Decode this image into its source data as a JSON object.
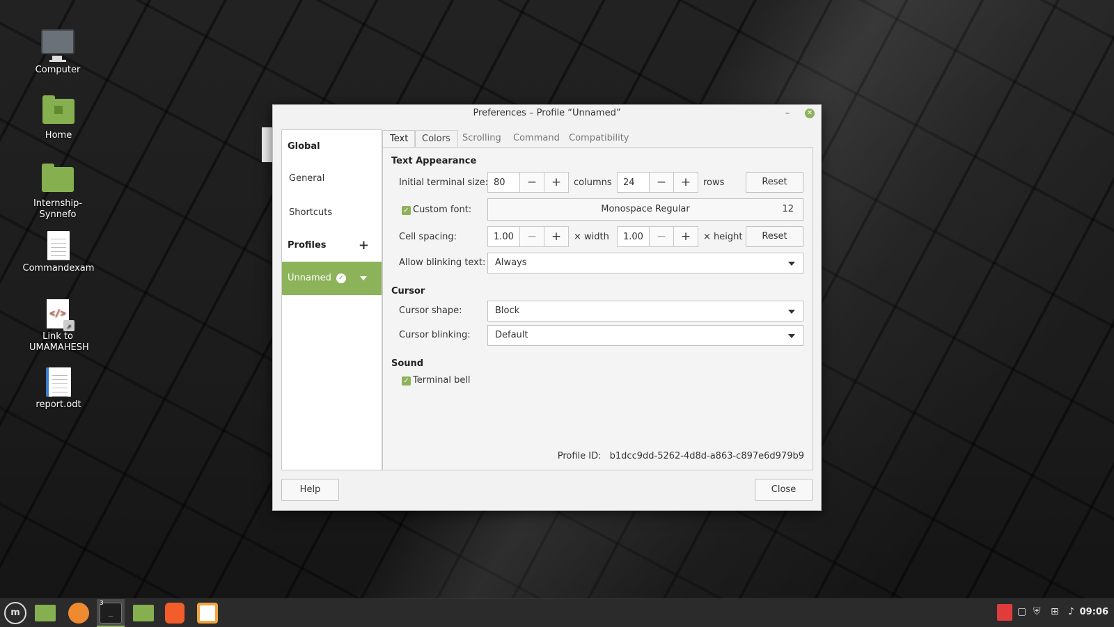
{
  "desktop": {
    "icons": [
      {
        "label": "Computer"
      },
      {
        "label": "Home"
      },
      {
        "label": "Internship-Synnefo"
      },
      {
        "label": "Commandexam"
      },
      {
        "label": "Link to UMAMAHESH"
      },
      {
        "label": "report.odt"
      }
    ]
  },
  "dialog": {
    "title": "Preferences – Profile “Unnamed”",
    "minimize_glyph": "–",
    "close_glyph": "✕",
    "sidebar": {
      "global_header": "Global",
      "general": "General",
      "shortcuts": "Shortcuts",
      "profiles_header": "Profiles",
      "add_glyph": "+",
      "profile_name": "Unnamed",
      "profile_check": "✓"
    },
    "tabs": [
      "Text",
      "Colors",
      "Scrolling",
      "Command",
      "Compatibility"
    ],
    "text_tab": {
      "appearance_title": "Text Appearance",
      "initial_size_label": "Initial terminal size:",
      "columns_value": "80",
      "columns_label": "columns",
      "rows_value": "24",
      "rows_label": "rows",
      "reset_label": "Reset",
      "minus_glyph": "−",
      "plus_glyph": "+",
      "custom_font_label": "Custom font:",
      "custom_font_checked": true,
      "font_name": "Monospace Regular",
      "font_size": "12",
      "cell_spacing_label": "Cell spacing:",
      "cell_width_value": "1.00",
      "cell_width_label": "× width",
      "cell_height_value": "1.00",
      "cell_height_label": "× height",
      "blinking_text_label": "Allow blinking text:",
      "blinking_text_value": "Always",
      "cursor_title": "Cursor",
      "cursor_shape_label": "Cursor shape:",
      "cursor_shape_value": "Block",
      "cursor_blinking_label": "Cursor blinking:",
      "cursor_blinking_value": "Default",
      "sound_title": "Sound",
      "terminal_bell_label": "Terminal bell",
      "terminal_bell_checked": true,
      "checkmark_glyph": "✓",
      "profile_id_label": "Profile ID:",
      "profile_id_value": "b1dcc9dd-5262-4d8d-a863-c897e6d979b9"
    },
    "help_label": "Help",
    "close_label": "Close"
  },
  "taskbar": {
    "menu_glyph": "m",
    "terminal_badge": "3",
    "clock": "09:06"
  },
  "colors": {
    "accent": "#8db35a",
    "taskbar": "#2b2b2b"
  }
}
